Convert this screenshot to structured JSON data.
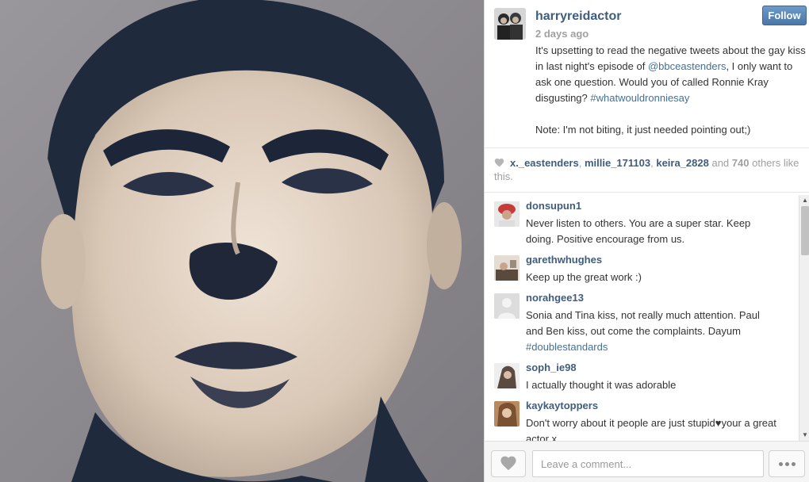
{
  "post": {
    "username": "harryreidactor",
    "timestamp": "2 days ago",
    "follow_label": "Follow",
    "caption_part1": "It's upsetting to read the negative tweets about the gay kiss in last night's episode of ",
    "caption_mention": "@bbceastenders",
    "caption_part2": ", I only want to ask one question. Would you of called Ronnie Kray disgusting? ",
    "caption_hashtag": "#whatwouldronniesay",
    "caption_note": "Note: I'm not biting, it just needed pointing out;)"
  },
  "likes": {
    "user1": "x._eastenders",
    "sep1": ", ",
    "user2": "millie_171103",
    "sep2": ", ",
    "user3": "keira_2828",
    "and_text": " and ",
    "count": "740",
    "tail": " others like this."
  },
  "comments": [
    {
      "user": "donsupun1",
      "text": "Never listen to others. You are a super star. Keep doing. Positive encourage from us.",
      "avatar_color": "#c73a3a"
    },
    {
      "user": "garethwhughes",
      "text": "Keep up the great work :)",
      "avatar_color": "#8a7260"
    },
    {
      "user": "norahgee13",
      "text_part1": "Sonia and Tina kiss, not really much attention. Paul and Ben kiss, out come the complaints. Dayum ",
      "hashtag": "#doublestandards",
      "avatar_color": "#d8d8d8"
    },
    {
      "user": "soph_ie98",
      "text": "I actually thought it was adorable",
      "avatar_color": "#7c6a5c"
    },
    {
      "user": "kaykaytoppers",
      "text": "Don't worry about it people are just stupid♥your a great actor x",
      "avatar_color": "#c79b6c"
    }
  ],
  "footer": {
    "comment_placeholder": "Leave a comment..."
  },
  "icons": {
    "heart": "heart-icon",
    "more": "more-options-icon"
  },
  "colors": {
    "username": "#3f5d7d",
    "link": "#3f729b",
    "follow_button": "#4a77a8",
    "muted": "#a0a0a0"
  }
}
